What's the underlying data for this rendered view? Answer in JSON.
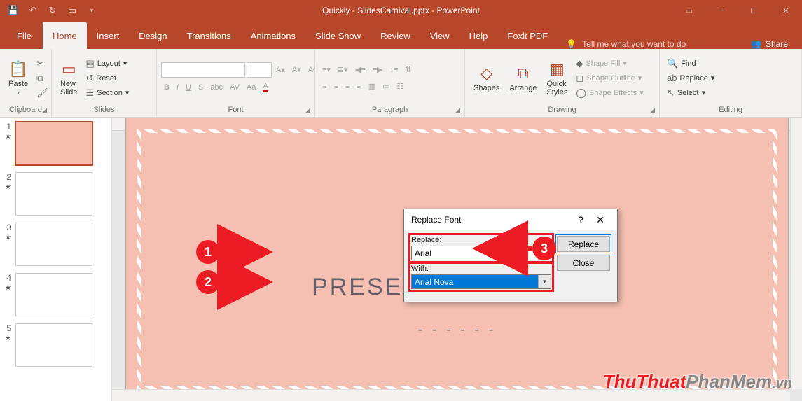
{
  "titlebar": {
    "doc_title": "Quickly - SlidesCarnival.pptx - PowerPoint"
  },
  "tabs": {
    "file": "File",
    "list": [
      "Home",
      "Insert",
      "Design",
      "Transitions",
      "Animations",
      "Slide Show",
      "Review",
      "View",
      "Help",
      "Foxit PDF"
    ],
    "active_index": 0,
    "tellme": "Tell me what you want to do",
    "share": "Share"
  },
  "ribbon": {
    "clipboard": {
      "label": "Clipboard",
      "paste": "Paste"
    },
    "slides": {
      "label": "Slides",
      "new_slide": "New\nSlide",
      "layout": "Layout",
      "reset": "Reset",
      "section": "Section"
    },
    "font": {
      "label": "Font"
    },
    "paragraph": {
      "label": "Paragraph"
    },
    "drawing": {
      "label": "Drawing",
      "shapes": "Shapes",
      "arrange": "Arrange",
      "quick": "Quick\nStyles",
      "fill": "Shape Fill",
      "outline": "Shape Outline",
      "effects": "Shape Effects"
    },
    "editing": {
      "label": "Editing",
      "find": "Find",
      "replace": "Replace",
      "select": "Select"
    }
  },
  "dialog": {
    "title": "Replace Font",
    "replace_label": "Replace:",
    "replace_value": "Arial",
    "with_label": "With:",
    "with_value": "Arial Nova",
    "btn_replace": "Replace",
    "btn_close": "Close"
  },
  "slide": {
    "title_suffix": "R",
    "title_line2": "PRESENTATION TITLE"
  },
  "annotations": {
    "a1": "1",
    "a2": "2",
    "a3": "3"
  },
  "thumbs": [
    "1",
    "2",
    "3",
    "4",
    "5"
  ],
  "watermark": {
    "main": "ThuThuat",
    "rest": "PhanMem",
    "tld": ".vn"
  }
}
